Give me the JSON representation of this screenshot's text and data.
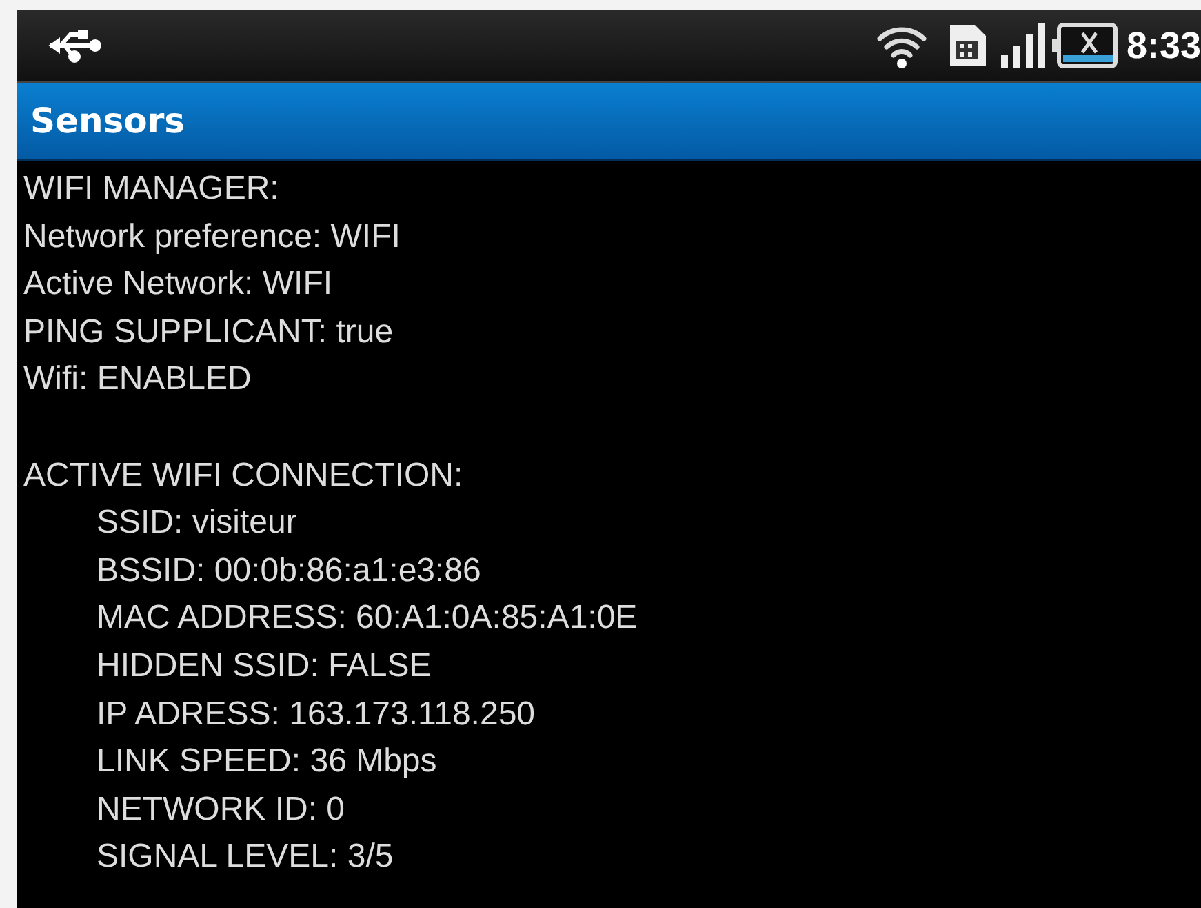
{
  "status_bar": {
    "time": "8:33"
  },
  "title": "Sensors",
  "sections": [
    {
      "heading": "WIFI MANAGER:",
      "indented": false,
      "lines": [
        "Network preference: WIFI",
        "Active Network: WIFI",
        "PING SUPPLICANT: true",
        "Wifi: ENABLED"
      ]
    },
    {
      "heading": "ACTIVE WIFI CONNECTION:",
      "indented": true,
      "lines": [
        "SSID: visiteur",
        "BSSID: 00:0b:86:a1:e3:86",
        "MAC ADDRESS: 60:A1:0A:85:A1:0E",
        "HIDDEN SSID: FALSE",
        "IP ADRESS: 163.173.118.250",
        "LINK SPEED: 36 Mbps",
        "NETWORK ID: 0",
        "SIGNAL LEVEL: 3/5"
      ]
    }
  ]
}
